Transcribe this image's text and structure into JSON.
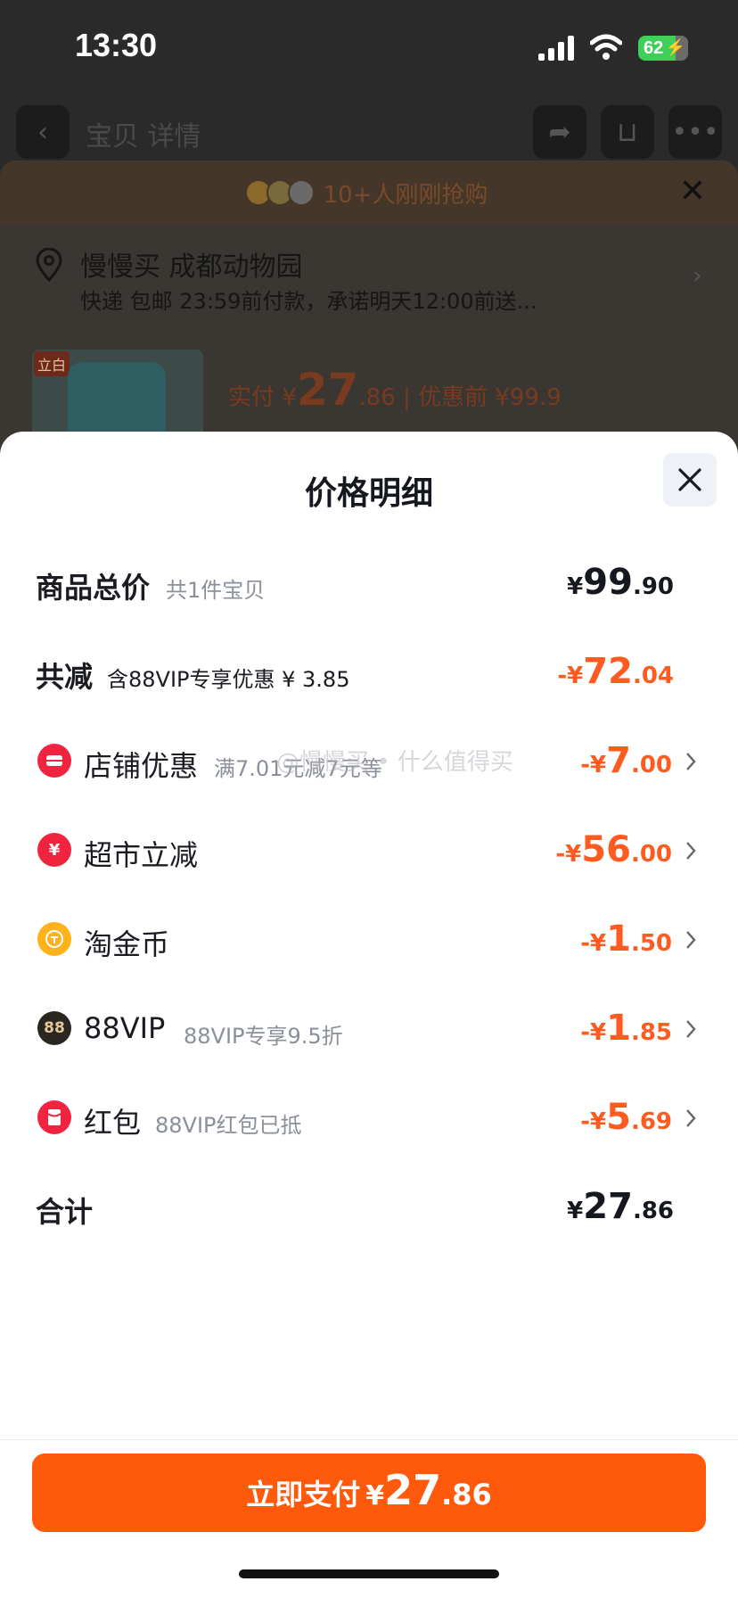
{
  "status_bar": {
    "time": "13:30",
    "battery": "62"
  },
  "background": {
    "nav_title": "宝贝  详情",
    "promo": "10+人刚刚抢购",
    "address": {
      "line1": "慢慢买 成都动物园",
      "line2": "快递 包邮 23:59前付款，承诺明天12:00前送..."
    },
    "product": {
      "tag": "立白",
      "pay_label": "实付 ¥",
      "pay_int": "27",
      "pay_dec": ".86",
      "sep": "|",
      "orig": "优惠前 ¥99.9"
    }
  },
  "modal": {
    "title": "价格明细",
    "rows": [
      {
        "label": "商品总价",
        "sub": "共1件宝贝",
        "amount": {
          "cur": "¥",
          "int": "99",
          "dec": ".90"
        }
      },
      {
        "label": "共减",
        "sub": "含88VIP专享优惠 ¥ 3.85",
        "amount": {
          "cur": "-¥",
          "int": "72",
          "dec": ".04"
        }
      },
      {
        "label": "店铺优惠",
        "sub": "满7.01元减7元等",
        "amount": {
          "cur": "-¥",
          "int": "7",
          "dec": ".00"
        },
        "icon": "shop-coupon-icon"
      },
      {
        "label": "超市立减",
        "sub": "",
        "amount": {
          "cur": "-¥",
          "int": "56",
          "dec": ".00"
        },
        "icon": "yuan-discount-icon"
      },
      {
        "label": "淘金币",
        "sub": "",
        "amount": {
          "cur": "-¥",
          "int": "1",
          "dec": ".50"
        },
        "icon": "coin-icon"
      },
      {
        "label": "88VIP",
        "sub": "88VIP专享9.5折",
        "amount": {
          "cur": "-¥",
          "int": "1",
          "dec": ".85"
        },
        "icon": "vip-88-icon",
        "icon_text": "88"
      },
      {
        "label": "红包",
        "sub": "88VIP红包已抵",
        "amount": {
          "cur": "-¥",
          "int": "5",
          "dec": ".69"
        },
        "icon": "red-packet-icon"
      },
      {
        "label": "合计",
        "sub": "",
        "amount": {
          "cur": "¥",
          "int": "27",
          "dec": ".86"
        }
      }
    ],
    "watermark": "@慢慢买 • 什么值得买"
  },
  "footer": {
    "pay_button": {
      "label": "立即支付",
      "cur": "¥",
      "int": "27",
      "dec": ".86"
    }
  },
  "colors": {
    "accent": "#ff5a0c",
    "discount": "#ff5a1f",
    "text": "#16181f",
    "muted": "#8a8f99"
  }
}
